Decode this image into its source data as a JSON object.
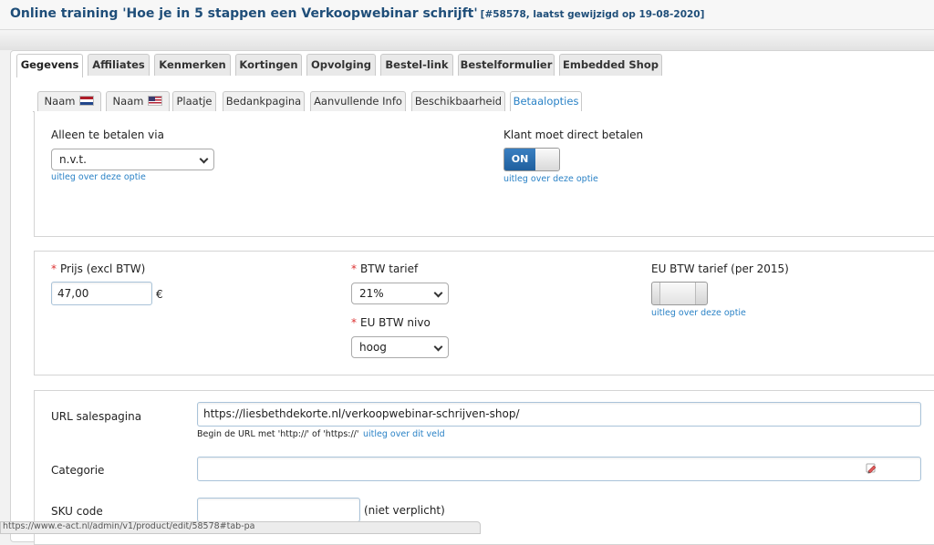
{
  "header": {
    "title": "Online training 'Hoe je in 5 stappen een Verkoopwebinar schrijft'",
    "meta": "[#58578, laatst gewijzigd op 19-08-2020]"
  },
  "main_tabs": [
    {
      "label": "Gegevens",
      "active": true
    },
    {
      "label": "Affiliates"
    },
    {
      "label": "Kenmerken"
    },
    {
      "label": "Kortingen"
    },
    {
      "label": "Opvolging"
    },
    {
      "label": "Bestel-link"
    },
    {
      "label": "Bestelformulier"
    },
    {
      "label": "Embedded Shop"
    }
  ],
  "sub_tabs": [
    {
      "label": "Naam",
      "flag": "flag-nl-icon"
    },
    {
      "label": "Naam",
      "flag": "flag-us-icon"
    },
    {
      "label": "Plaatje"
    },
    {
      "label": "Bedankpagina"
    },
    {
      "label": "Aanvullende Info"
    },
    {
      "label": "Beschikbaarheid"
    },
    {
      "label": "Betaalopties",
      "active": true
    }
  ],
  "payment": {
    "only_pay_via_label": "Alleen te betalen via",
    "only_pay_via_value": "n.v.t.",
    "only_pay_via_help": "uitleg over deze optie",
    "direct_pay_label": "Klant moet direct betalen",
    "direct_pay_state": "ON",
    "direct_pay_help": "uitleg over deze optie"
  },
  "pricing": {
    "required_mark": "*",
    "price_label": "Prijs (excl BTW)",
    "price_value": "47,00",
    "currency": "€",
    "vat_rate_label": "BTW tarief",
    "vat_rate_value": "21%",
    "eu_vat_level_label": "EU BTW nivo",
    "eu_vat_level_value": "hoog",
    "eu_vat_rate_label": "EU BTW tarief (per 2015)",
    "eu_vat_rate_help": "uitleg over deze optie"
  },
  "details": {
    "url_label": "URL salespagina",
    "url_value": "https://liesbethdekorte.nl/verkoopwebinar-schrijven-shop/",
    "url_hint": "Begin de URL met 'http://' of 'https://'",
    "url_help": "uitleg over dit veld",
    "category_label": "Categorie",
    "category_value": "",
    "sku_label": "SKU code",
    "sku_value": "",
    "sku_note": "(niet verplicht)"
  },
  "status_bar": {
    "text": "https://www.e-act.nl/admin/v1/product/edit/58578#tab-pa"
  },
  "colors": {
    "title": "#1f4e79",
    "link": "#2a82c6",
    "toggle_on": "#2a6fb0",
    "required": "#dd3333"
  }
}
